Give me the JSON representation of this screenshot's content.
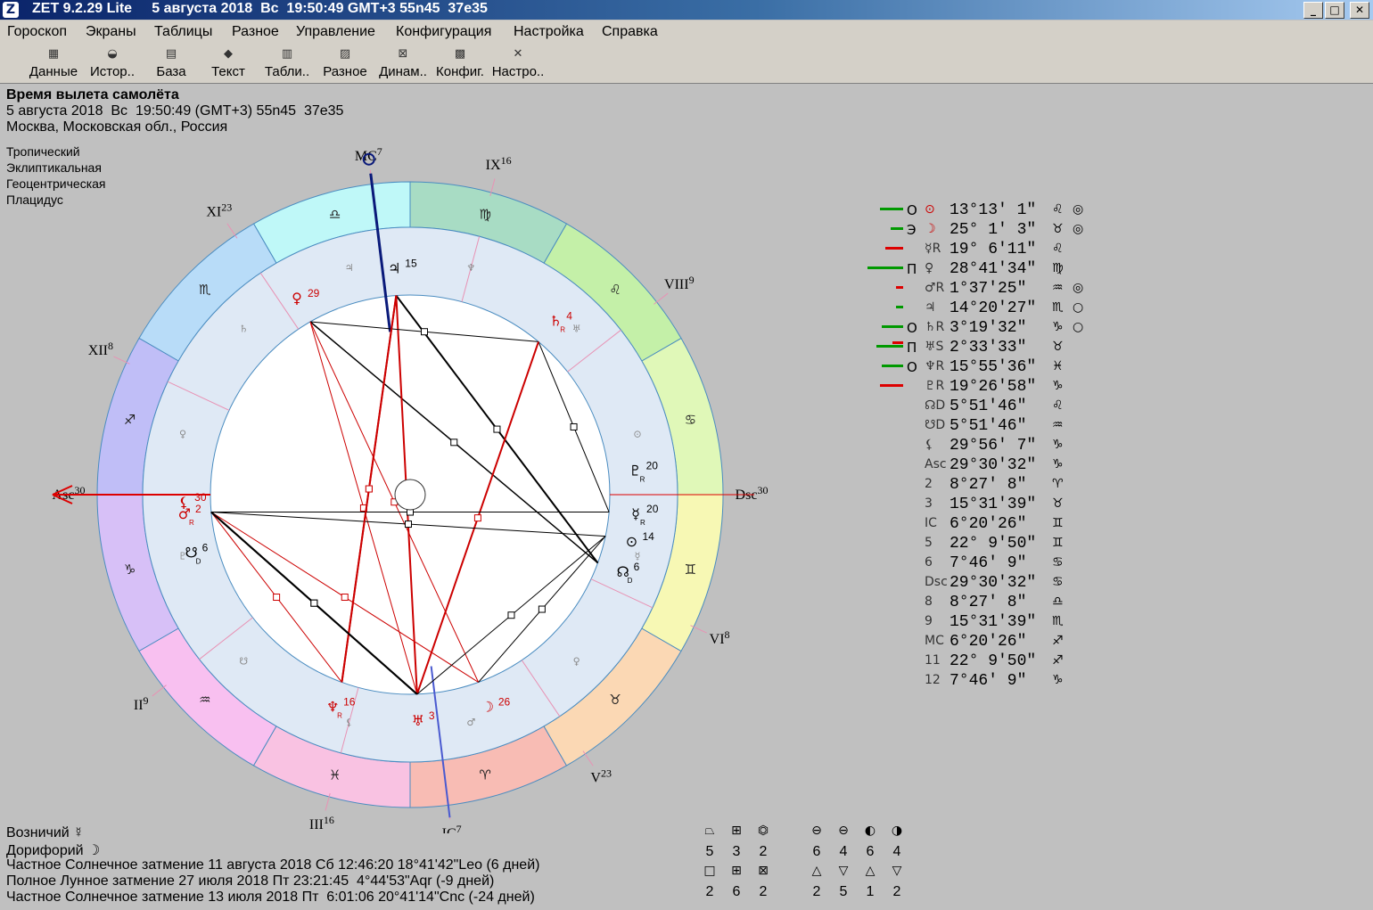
{
  "window": {
    "title": "ZET 9.2.29 Lite     5 августа 2018  Вс  19:50:49 GMT+3 55n45  37e35",
    "min_glyph": "_",
    "max_glyph": "□",
    "close_glyph": "✕"
  },
  "menu": [
    "Гороскоп",
    "Экраны",
    "Таблицы",
    "Разное",
    "Управление",
    "Конфигурация",
    "Настройка",
    "Справка"
  ],
  "toolbar": [
    {
      "label": "Данные",
      "icon": "data-icon",
      "glyph": "▦"
    },
    {
      "label": "Истор..",
      "icon": "history-icon",
      "glyph": "◒"
    },
    {
      "label": "База",
      "icon": "database-icon",
      "glyph": "▤"
    },
    {
      "label": "Текст",
      "icon": "text-icon",
      "glyph": "◆"
    },
    {
      "label": "Табли..",
      "icon": "table-icon",
      "glyph": "▥"
    },
    {
      "label": "Разное",
      "icon": "misc-icon",
      "glyph": "▨"
    },
    {
      "label": "Динам..",
      "icon": "dynamics-icon",
      "glyph": "⊠"
    },
    {
      "label": "Конфиг.",
      "icon": "config-icon",
      "glyph": "▩"
    },
    {
      "label": "Настро..",
      "icon": "settings-icon",
      "glyph": "✕"
    }
  ],
  "chart": {
    "title": "Время вылета самолёта",
    "datetime": "5 августа 2018  Вс  19:50:49 (GMT+3) 55n45  37e35",
    "place": "Москва, Московская обл., Россия",
    "settings": [
      "Тропический",
      "Эклиптикальная",
      "Геоцентрическая",
      "Плацидус"
    ],
    "houses": [
      {
        "label": "Asc",
        "sup": "30"
      },
      {
        "label": "II",
        "sup": "9"
      },
      {
        "label": "III",
        "sup": "16"
      },
      {
        "label": "IC",
        "sup": "7"
      },
      {
        "label": "V",
        "sup": "23"
      },
      {
        "label": "VI",
        "sup": "8"
      },
      {
        "label": "Dsc",
        "sup": "30"
      },
      {
        "label": "VIII",
        "sup": "9"
      },
      {
        "label": "IX",
        "sup": "16"
      },
      {
        "label": "MC",
        "sup": "7"
      },
      {
        "label": "XI",
        "sup": "23"
      },
      {
        "label": "XII",
        "sup": "8"
      }
    ],
    "signs": [
      "♑",
      "♒",
      "♓",
      "♈",
      "♉",
      "♊",
      "♋",
      "♌",
      "♍",
      "♎",
      "♏",
      "♐"
    ],
    "sign_colors": [
      "#d7c0f7",
      "#f8c0f0",
      "#f9c2e2",
      "#f8bcb4",
      "#fbd8b4",
      "#f7f8b4",
      "#e0f8b8",
      "#c4f0a8",
      "#a8dcc4",
      "#bff8f8",
      "#b8dcf8",
      "#c0bef7"
    ],
    "planets": [
      {
        "glyph": "⊙",
        "deg": "14",
        "color": "#000",
        "sub": ""
      },
      {
        "glyph": "☿",
        "deg": "20",
        "color": "#000",
        "sub": "R"
      },
      {
        "glyph": "☊",
        "deg": "6",
        "color": "#000",
        "sub": "D"
      },
      {
        "glyph": "♀",
        "deg": "29",
        "color": "#cc0000",
        "sub": ""
      },
      {
        "glyph": "♃",
        "deg": "15",
        "color": "#000",
        "sub": ""
      },
      {
        "glyph": "♄",
        "deg": "4",
        "color": "#cc0000",
        "sub": "R"
      },
      {
        "glyph": "♇",
        "deg": "20",
        "color": "#000",
        "sub": "R"
      },
      {
        "glyph": "⚸",
        "deg": "30",
        "color": "#cc0000",
        "sub": ""
      },
      {
        "glyph": "♂",
        "deg": "2",
        "color": "#cc0000",
        "sub": "R"
      },
      {
        "glyph": "☋",
        "deg": "6",
        "color": "#000",
        "sub": "D"
      },
      {
        "glyph": "♆",
        "deg": "16",
        "color": "#cc0000",
        "sub": "R"
      },
      {
        "glyph": "♅",
        "deg": "3",
        "color": "#cc0000",
        "sub": ""
      },
      {
        "glyph": "☽",
        "deg": "26",
        "color": "#cc0000",
        "sub": ""
      }
    ],
    "aspects": [
      {
        "from": 3,
        "to": 2,
        "color": "#000",
        "w": 1.5
      },
      {
        "from": 4,
        "to": 2,
        "color": "#000",
        "w": 2
      },
      {
        "from": 4,
        "to": 11,
        "color": "#cc0000",
        "w": 2
      },
      {
        "from": 4,
        "to": 10,
        "color": "#cc0000",
        "w": 2
      },
      {
        "from": 3,
        "to": 5,
        "color": "#000",
        "w": 1
      },
      {
        "from": 3,
        "to": 11,
        "color": "#cc0000",
        "w": 1
      },
      {
        "from": 3,
        "to": 12,
        "color": "#cc0000",
        "w": 1
      },
      {
        "from": 5,
        "to": 1,
        "color": "#000",
        "w": 1
      },
      {
        "from": 5,
        "to": 11,
        "color": "#cc0000",
        "w": 2
      },
      {
        "from": 8,
        "to": 11,
        "color": "#000",
        "w": 2
      },
      {
        "from": 8,
        "to": 12,
        "color": "#cc0000",
        "w": 1
      },
      {
        "from": 8,
        "to": 0,
        "color": "#000",
        "w": 1
      },
      {
        "from": 8,
        "to": 1,
        "color": "#000",
        "w": 1
      },
      {
        "from": 0,
        "to": 11,
        "color": "#000",
        "w": 1
      },
      {
        "from": 0,
        "to": 12,
        "color": "#000",
        "w": 1
      },
      {
        "from": 10,
        "to": 4,
        "color": "#cc0000",
        "w": 2
      },
      {
        "from": 10,
        "to": 8,
        "color": "#cc0000",
        "w": 1
      },
      {
        "from": 11,
        "to": 8,
        "color": "#000",
        "w": 2
      }
    ],
    "inner_glyphs": [
      "♇",
      "☋",
      "⚸",
      "♂",
      "♀",
      "☿",
      "⊙",
      "♅",
      "♆",
      "♃",
      "♄",
      "♀",
      "♃"
    ]
  },
  "positions": [
    {
      "bar": "#009900",
      "barw": 26,
      "bar2": "",
      "bar2w": 0,
      "asp": "О",
      "glyph": "⊙",
      "red": true,
      "deg": "13°13' 1\"",
      "sign": "♌",
      "extra": "◎"
    },
    {
      "bar": "#009900",
      "barw": 14,
      "bar2": "",
      "bar2w": 0,
      "asp": "Э",
      "glyph": "☽",
      "red": true,
      "deg": "25° 1' 3\"",
      "sign": "♉",
      "extra": "◎"
    },
    {
      "bar": "#dd0000",
      "barw": 20,
      "bar2": "",
      "bar2w": 0,
      "asp": "",
      "glyph": "☿R",
      "red": false,
      "deg": "19° 6'11\"",
      "sign": "♌",
      "extra": ""
    },
    {
      "bar": "#009900",
      "barw": 40,
      "bar2": "",
      "bar2w": 0,
      "asp": "П",
      "glyph": "♀",
      "red": false,
      "deg": "28°41'34\"",
      "sign": "♍",
      "extra": ""
    },
    {
      "bar": "#dd0000",
      "barw": 8,
      "bar2": "",
      "bar2w": 0,
      "asp": "",
      "glyph": "♂R",
      "red": false,
      "deg": " 1°37'25\"",
      "sign": "♒",
      "extra": "◎"
    },
    {
      "bar": "#009900",
      "barw": 8,
      "bar2": "",
      "bar2w": 0,
      "asp": "",
      "glyph": "♃",
      "red": false,
      "deg": "14°20'27\"",
      "sign": "♏",
      "extra": "○"
    },
    {
      "bar": "#009900",
      "barw": 24,
      "bar2": "",
      "bar2w": 0,
      "asp": "О",
      "glyph": "♄R",
      "red": false,
      "deg": " 3°19'32\"",
      "sign": "♑",
      "extra": "○"
    },
    {
      "bar": "#009900",
      "barw": 30,
      "bar2": "#dd0000",
      "bar2w": 12,
      "asp": "П",
      "glyph": "♅S",
      "red": false,
      "deg": " 2°33'33\"",
      "sign": "♉",
      "extra": ""
    },
    {
      "bar": "#009900",
      "barw": 24,
      "bar2": "",
      "bar2w": 0,
      "asp": "О",
      "glyph": "♆R",
      "red": false,
      "deg": "15°55'36\"",
      "sign": "♓",
      "extra": ""
    },
    {
      "bar": "#dd0000",
      "barw": 26,
      "bar2": "",
      "bar2w": 0,
      "asp": "",
      "glyph": "♇R",
      "red": false,
      "deg": "19°26'58\"",
      "sign": "♑",
      "extra": ""
    },
    {
      "bar": "",
      "barw": 0,
      "bar2": "",
      "bar2w": 0,
      "asp": "",
      "glyph": "☊D",
      "red": false,
      "deg": " 5°51'46\"",
      "sign": "♌",
      "extra": ""
    },
    {
      "bar": "",
      "barw": 0,
      "bar2": "",
      "bar2w": 0,
      "asp": "",
      "glyph": "☋D",
      "red": false,
      "deg": " 5°51'46\"",
      "sign": "♒",
      "extra": ""
    },
    {
      "bar": "",
      "barw": 0,
      "bar2": "",
      "bar2w": 0,
      "asp": "",
      "glyph": "⚸",
      "red": false,
      "deg": "29°56' 7\"",
      "sign": "♑",
      "extra": ""
    },
    {
      "bar": "",
      "barw": 0,
      "bar2": "",
      "bar2w": 0,
      "asp": "",
      "glyph": "Asc",
      "red": false,
      "deg": "29°30'32\"",
      "sign": "♑",
      "extra": ""
    },
    {
      "bar": "",
      "barw": 0,
      "bar2": "",
      "bar2w": 0,
      "asp": "",
      "glyph": "2",
      "red": false,
      "deg": " 8°27' 8\"",
      "sign": "♈",
      "extra": ""
    },
    {
      "bar": "",
      "barw": 0,
      "bar2": "",
      "bar2w": 0,
      "asp": "",
      "glyph": "3",
      "red": false,
      "deg": "15°31'39\"",
      "sign": "♉",
      "extra": ""
    },
    {
      "bar": "",
      "barw": 0,
      "bar2": "",
      "bar2w": 0,
      "asp": "",
      "glyph": "IC",
      "red": false,
      "deg": " 6°20'26\"",
      "sign": "♊",
      "extra": ""
    },
    {
      "bar": "",
      "barw": 0,
      "bar2": "",
      "bar2w": 0,
      "asp": "",
      "glyph": "5",
      "red": false,
      "deg": "22° 9'50\"",
      "sign": "♊",
      "extra": ""
    },
    {
      "bar": "",
      "barw": 0,
      "bar2": "",
      "bar2w": 0,
      "asp": "",
      "glyph": "6",
      "red": false,
      "deg": " 7°46' 9\"",
      "sign": "♋",
      "extra": ""
    },
    {
      "bar": "",
      "barw": 0,
      "bar2": "",
      "bar2w": 0,
      "asp": "",
      "glyph": "Dsc",
      "red": false,
      "deg": "29°30'32\"",
      "sign": "♋",
      "extra": ""
    },
    {
      "bar": "",
      "barw": 0,
      "bar2": "",
      "bar2w": 0,
      "asp": "",
      "glyph": "8",
      "red": false,
      "deg": " 8°27' 8\"",
      "sign": "♎",
      "extra": ""
    },
    {
      "bar": "",
      "barw": 0,
      "bar2": "",
      "bar2w": 0,
      "asp": "",
      "glyph": "9",
      "red": false,
      "deg": "15°31'39\"",
      "sign": "♏",
      "extra": ""
    },
    {
      "bar": "",
      "barw": 0,
      "bar2": "",
      "bar2w": 0,
      "asp": "",
      "glyph": "MC",
      "red": false,
      "deg": " 6°20'26\"",
      "sign": "♐",
      "extra": ""
    },
    {
      "bar": "",
      "barw": 0,
      "bar2": "",
      "bar2w": 0,
      "asp": "",
      "glyph": "11",
      "red": false,
      "deg": "22° 9'50\"",
      "sign": "♐",
      "extra": ""
    },
    {
      "bar": "",
      "barw": 0,
      "bar2": "",
      "bar2w": 0,
      "asp": "",
      "glyph": "12",
      "red": false,
      "deg": " 7°46' 9\"",
      "sign": "♑",
      "extra": ""
    }
  ],
  "footer": {
    "lines": [
      "Возничий ☿",
      "Дорифорий ☽",
      "Частное Солнечное затмение 11 августа 2018 Сб 12:46:20 18°41'42\"Leo (6 дней)",
      "Полное Лунное затмение 27 июля 2018 Пт 23:21:45  4°44'53\"Aqr (-9 дней)",
      "Частное Солнечное затмение 13 июля 2018 Пт  6:01:06 20°41'14\"Cnc (-24 дней)"
    ],
    "stats": {
      "group1_syms": [
        "⏢",
        "⊞",
        "⏣"
      ],
      "group1_vals": [
        "5",
        "3",
        "2"
      ],
      "group1_syms2": [
        "□",
        "⊞",
        "⊠"
      ],
      "group1_vals2": [
        "2",
        "6",
        "2"
      ],
      "group2_syms": [
        "⊖",
        "⊖",
        "◐",
        "◑"
      ],
      "group2_vals": [
        "6",
        "4",
        "6",
        "4"
      ],
      "group2_syms2": [
        "△",
        "▽",
        "△",
        "▽"
      ],
      "group2_vals2": [
        "2",
        "5",
        "1",
        "2"
      ]
    }
  }
}
